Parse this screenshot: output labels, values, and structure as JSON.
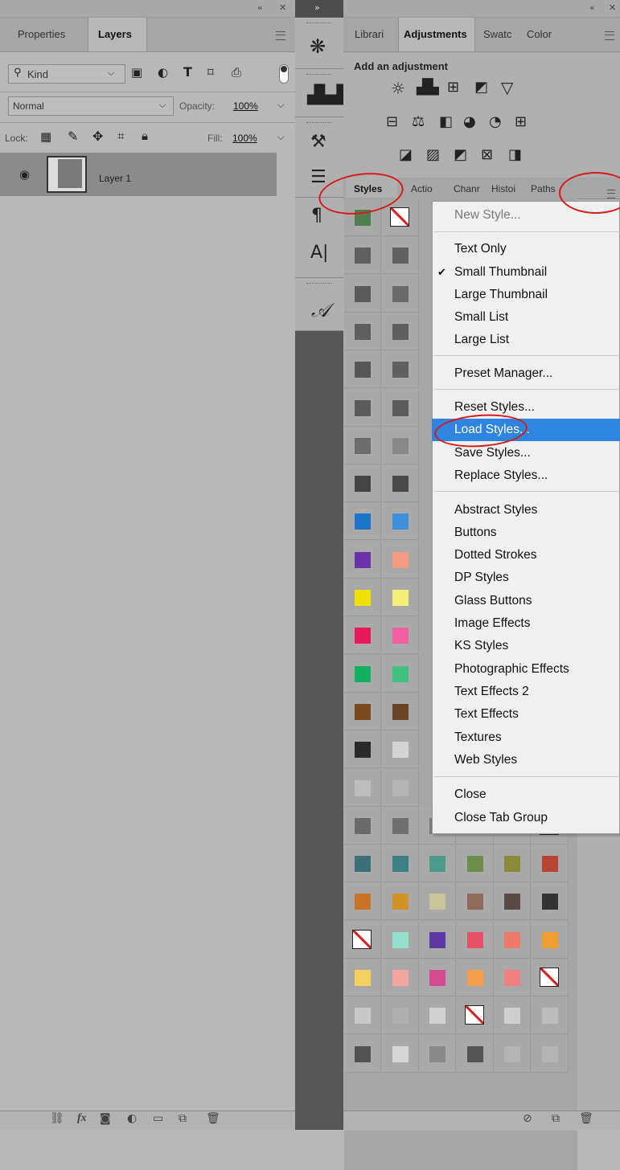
{
  "left_panel": {
    "tabs": [
      "Properties",
      "Layers"
    ],
    "active_tab": "Layers",
    "filter": {
      "label": "Kind"
    },
    "blend_mode": "Normal",
    "opacity": {
      "label": "Opacity:",
      "value": "100%"
    },
    "lock": {
      "label": "Lock:"
    },
    "fill": {
      "label": "Fill:",
      "value": "100%"
    },
    "layers": [
      {
        "name": "Layer 1",
        "visible": true
      }
    ],
    "footer_icons": [
      "link-icon",
      "fx-icon",
      "mask-icon",
      "adjustment-icon",
      "folder-icon",
      "new-layer-icon",
      "trash-icon"
    ],
    "footer_fx": "fx"
  },
  "right_panel": {
    "top_tabs": [
      "Librari",
      "Adjustments",
      "Swatc",
      "Color"
    ],
    "active_top_tab": "Adjustments",
    "add_adjustment": "Add an adjustment",
    "bottom_tabs": [
      "Styles",
      "Actio",
      "Chanr",
      "Histoi",
      "Paths"
    ],
    "active_bottom_tab": "Styles"
  },
  "context_menu": {
    "items": [
      {
        "label": "New Style...",
        "disabled": true
      },
      {
        "label": "Text Only"
      },
      {
        "label": "Small Thumbnail",
        "checked": true
      },
      {
        "label": "Large Thumbnail"
      },
      {
        "label": "Small List"
      },
      {
        "label": "Large List"
      },
      {
        "label": "Preset Manager..."
      },
      {
        "label": "Reset Styles..."
      },
      {
        "label": "Load Styles...",
        "highlighted": true
      },
      {
        "label": "Save Styles..."
      },
      {
        "label": "Replace Styles..."
      },
      {
        "label": "Abstract Styles"
      },
      {
        "label": "Buttons"
      },
      {
        "label": "Dotted Strokes"
      },
      {
        "label": "DP Styles"
      },
      {
        "label": "Glass Buttons"
      },
      {
        "label": "Image Effects"
      },
      {
        "label": "KS Styles"
      },
      {
        "label": "Photographic Effects"
      },
      {
        "label": "Text Effects 2"
      },
      {
        "label": "Text Effects"
      },
      {
        "label": "Textures"
      },
      {
        "label": "Web Styles"
      },
      {
        "label": "Close"
      },
      {
        "label": "Close Tab Group"
      }
    ],
    "check_mark": "✔"
  },
  "colors": {
    "highlight": "#2f84e0",
    "annotation": "#d81b1b",
    "panel_bg": "#b8b8b8"
  }
}
